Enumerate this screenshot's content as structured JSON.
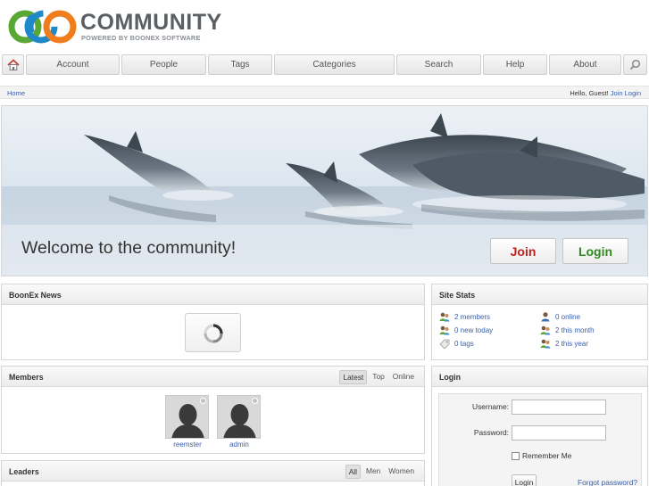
{
  "logo": {
    "name": "COMMUNITY",
    "tagline": "POWERED BY BOONEX SOFTWARE"
  },
  "nav": {
    "items": [
      "Account",
      "People",
      "Tags",
      "Categories",
      "Search",
      "Help",
      "About"
    ]
  },
  "crumb": {
    "home": "Home",
    "greeting": "Hello, Guest!",
    "join": "Join",
    "login": "Login"
  },
  "hero": {
    "title": "Welcome to the community!",
    "join_label": "Join",
    "login_label": "Login"
  },
  "news": {
    "title": "BoonEx News"
  },
  "members": {
    "title": "Members",
    "tabs": [
      "Latest",
      "Top",
      "Online"
    ],
    "active_tab": "Latest",
    "list": [
      {
        "name": "reemster"
      },
      {
        "name": "admin"
      }
    ]
  },
  "leaders": {
    "title": "Leaders",
    "tabs": [
      "All",
      "Men",
      "Women"
    ],
    "active_tab": "All"
  },
  "stats": {
    "title": "Site Stats",
    "left": [
      "2 members",
      "0 new today",
      "0 tags"
    ],
    "right": [
      "0 online",
      "2 this month",
      "2 this year"
    ]
  },
  "login": {
    "title": "Login",
    "username_label": "Username:",
    "password_label": "Password:",
    "remember_label": "Remember Me",
    "submit_label": "Login",
    "forgot_label": "Forgot password?"
  },
  "colors": {
    "accent_link": "#3a5ea8",
    "join_red": "#c0231e",
    "login_green": "#2e8a1e"
  }
}
